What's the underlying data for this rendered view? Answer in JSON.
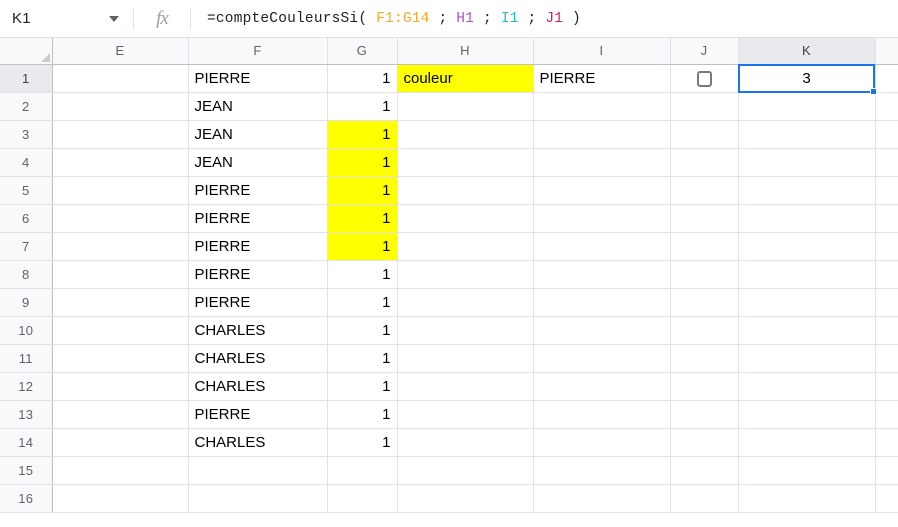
{
  "formula_bar": {
    "name_box_value": "K1",
    "caret_icon": "chevron-down-icon",
    "fx_icon": "fx-icon",
    "formula_prefix": "=compteCouleursSi( ",
    "formula_tokens": [
      {
        "text": "F1:G14",
        "color": "#f9a825"
      },
      {
        "text": " ; ",
        "color": "#202124"
      },
      {
        "text": "H1",
        "color": "#a855c8"
      },
      {
        "text": " ; ",
        "color": "#202124"
      },
      {
        "text": "I1",
        "color": "#29b6d0"
      },
      {
        "text": " ; ",
        "color": "#202124"
      },
      {
        "text": "J1",
        "color": "#d81b60"
      }
    ],
    "formula_suffix": " )",
    "formula_full": "=compteCouleursSi( F1:G14 ; H1 ; I1 ; J1 )"
  },
  "grid": {
    "column_headers": [
      "E",
      "F",
      "G",
      "H",
      "I",
      "J",
      "K"
    ],
    "selected_column": "K",
    "selected_row": "1",
    "row_headers": [
      "1",
      "2",
      "3",
      "4",
      "5",
      "6",
      "7",
      "8",
      "9",
      "10",
      "11",
      "12",
      "13",
      "14",
      "15",
      "16"
    ],
    "active_cell": "K1",
    "rows": [
      {
        "r": "1",
        "E": "",
        "F": "PIERRE",
        "G": "1",
        "H": "couleur",
        "I": "PIERRE",
        "J": "checkbox-unchecked",
        "K": "3"
      },
      {
        "r": "2",
        "E": "",
        "F": "JEAN",
        "G": "1",
        "H": "",
        "I": "",
        "J": "",
        "K": ""
      },
      {
        "r": "3",
        "E": "",
        "F": "JEAN",
        "G": "1",
        "H": "",
        "I": "",
        "J": "",
        "K": ""
      },
      {
        "r": "4",
        "E": "",
        "F": "JEAN",
        "G": "1",
        "H": "",
        "I": "",
        "J": "",
        "K": ""
      },
      {
        "r": "5",
        "E": "",
        "F": "PIERRE",
        "G": "1",
        "H": "",
        "I": "",
        "J": "",
        "K": ""
      },
      {
        "r": "6",
        "E": "",
        "F": "PIERRE",
        "G": "1",
        "H": "",
        "I": "",
        "J": "",
        "K": ""
      },
      {
        "r": "7",
        "E": "",
        "F": "PIERRE",
        "G": "1",
        "H": "",
        "I": "",
        "J": "",
        "K": ""
      },
      {
        "r": "8",
        "E": "",
        "F": "PIERRE",
        "G": "1",
        "H": "",
        "I": "",
        "J": "",
        "K": ""
      },
      {
        "r": "9",
        "E": "",
        "F": "PIERRE",
        "G": "1",
        "H": "",
        "I": "",
        "J": "",
        "K": ""
      },
      {
        "r": "10",
        "E": "",
        "F": "CHARLES",
        "G": "1",
        "H": "",
        "I": "",
        "J": "",
        "K": ""
      },
      {
        "r": "11",
        "E": "",
        "F": "CHARLES",
        "G": "1",
        "H": "",
        "I": "",
        "J": "",
        "K": ""
      },
      {
        "r": "12",
        "E": "",
        "F": "CHARLES",
        "G": "1",
        "H": "",
        "I": "",
        "J": "",
        "K": ""
      },
      {
        "r": "13",
        "E": "",
        "F": "PIERRE",
        "G": "1",
        "H": "",
        "I": "",
        "J": "",
        "K": ""
      },
      {
        "r": "14",
        "E": "",
        "F": "CHARLES",
        "G": "1",
        "H": "",
        "I": "",
        "J": "",
        "K": ""
      },
      {
        "r": "15",
        "E": "",
        "F": "",
        "G": "",
        "H": "",
        "I": "",
        "J": "",
        "K": ""
      },
      {
        "r": "16",
        "E": "",
        "F": "",
        "G": "",
        "H": "",
        "I": "",
        "J": "",
        "K": ""
      }
    ],
    "yellow_filled_cells": [
      "G3",
      "G4",
      "G5",
      "G6",
      "G7",
      "H1"
    ],
    "colors": {
      "fill_yellow": "#ffff00",
      "selection_blue": "#1a73e8",
      "header_bg": "#f8f9fa",
      "header_selected_bg": "#e8eaed",
      "gridline": "#e0e2e5"
    }
  }
}
